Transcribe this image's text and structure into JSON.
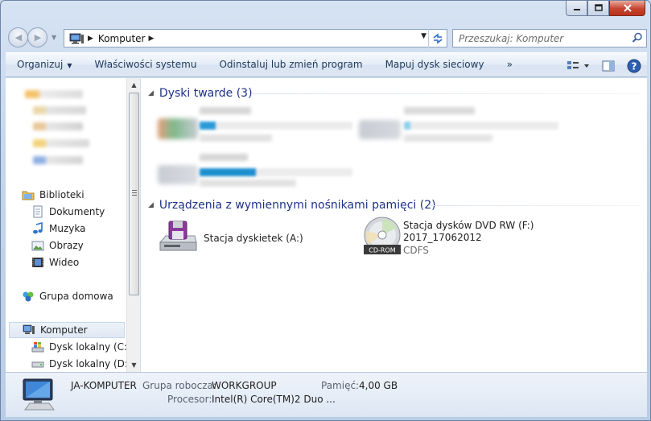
{
  "window": {
    "caption_buttons": [
      "minimize-icon",
      "maximize-icon",
      "close-icon"
    ]
  },
  "navigation": {
    "address_segment": "Komputer",
    "search_placeholder": "Przeszukaj: Komputer"
  },
  "toolbar": {
    "organize": "Organizuj",
    "system_properties": "Właściwości systemu",
    "uninstall": "Odinstaluj lub zmień program",
    "map_drive": "Mapuj dysk sieciowy",
    "more": "»"
  },
  "sidebar": {
    "libraries": "Biblioteki",
    "documents": "Dokumenty",
    "music": "Muzyka",
    "pictures": "Obrazy",
    "video": "Wideo",
    "homegroup": "Grupa domowa",
    "computer": "Komputer",
    "disk_c": "Dysk lokalny (C:)",
    "disk_d": "Dysk lokalny (D:)"
  },
  "main": {
    "hard_disks_header": "Dyski twarde (3)",
    "removable_header": "Urządzenia z wymiennymi nośnikami pamięci (2)",
    "floppy_label": "Stacja dyskietek (A:)",
    "dvd_label": "Stacja dysków DVD RW (F:)",
    "dvd_volume": "2017_17062012",
    "dvd_fs": "CDFS",
    "dvd_badge": "CD-ROM"
  },
  "details": {
    "computer_name": "JA-KOMPUTER",
    "workgroup_label": "Grupa robocza:",
    "workgroup_value": "WORKGROUP",
    "memory_label": "Pamięć:",
    "memory_value": "4,00 GB",
    "processor_label": "Procesor:",
    "processor_value": "Intel(R) Core(TM)2 Duo ..."
  },
  "colors": {
    "group_header": "#1e3287",
    "command_text": "#1e395b",
    "close_button": "#c7432e"
  }
}
